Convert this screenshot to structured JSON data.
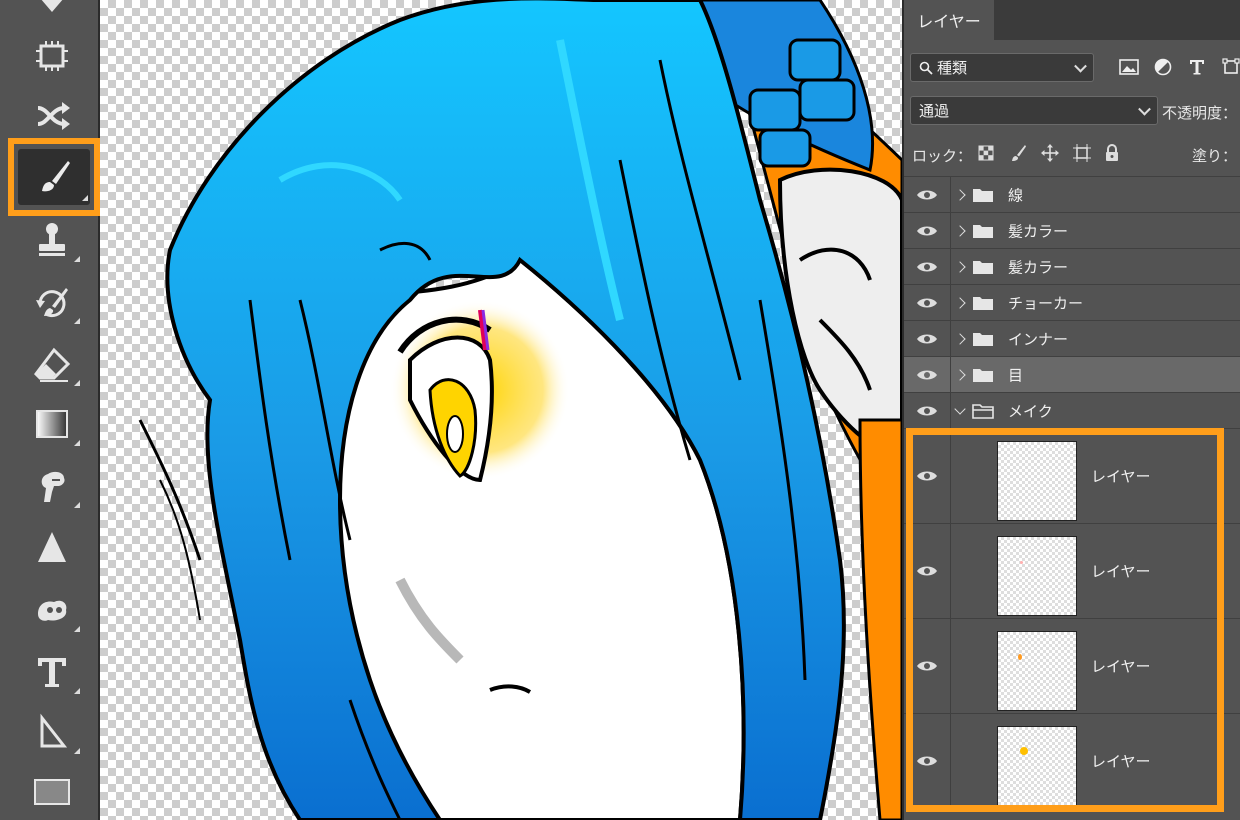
{
  "toolbar": {
    "tools": [
      {
        "name": "eraser-partial-icon",
        "active": false
      },
      {
        "name": "content-aware-icon",
        "active": false
      },
      {
        "name": "shuffle-icon",
        "active": false
      },
      {
        "name": "brush-icon",
        "active": true
      },
      {
        "name": "stamp-icon",
        "active": false
      },
      {
        "name": "history-brush-icon",
        "active": false
      },
      {
        "name": "eraser-icon",
        "active": false
      },
      {
        "name": "gradient-icon",
        "active": false
      },
      {
        "name": "smudge-icon",
        "active": false
      },
      {
        "name": "sharpen-icon",
        "active": false
      },
      {
        "name": "dodge-icon",
        "active": false
      },
      {
        "name": "type-icon",
        "active": false
      },
      {
        "name": "path-select-icon",
        "active": false
      },
      {
        "name": "rectangle-icon",
        "active": false
      }
    ],
    "highlight_color": "#ff9e1a"
  },
  "panel": {
    "tab_label": "レイヤー",
    "filter_label": "種類",
    "blend_mode": "通過",
    "opacity_label": "不透明度：",
    "lock_label": "ロック：",
    "fill_label": "塗り：",
    "groups": [
      {
        "name": "線",
        "expanded": false,
        "selected": false
      },
      {
        "name": "髪カラー",
        "expanded": false,
        "selected": false
      },
      {
        "name": "髪カラー",
        "expanded": false,
        "selected": false
      },
      {
        "name": "チョーカー",
        "expanded": false,
        "selected": false
      },
      {
        "name": "インナー",
        "expanded": false,
        "selected": false
      },
      {
        "name": "目",
        "expanded": false,
        "selected": true
      },
      {
        "name": "メイク",
        "expanded": true,
        "selected": false
      }
    ],
    "layers": [
      {
        "name": "レイヤー",
        "thumb_mark": null
      },
      {
        "name": "レイヤー",
        "thumb_mark": "#ffb0b0"
      },
      {
        "name": "レイヤー",
        "thumb_mark": "#ff9a20"
      },
      {
        "name": "レイヤー",
        "thumb_mark": "#ffc000"
      }
    ],
    "highlight_color": "#ff9e1a"
  },
  "canvas": {
    "hair_color": "#1a9ae6",
    "hair_light": "#2fd0ff",
    "eye_color": "#ffd400",
    "accent_orange": "#ff8c00"
  }
}
